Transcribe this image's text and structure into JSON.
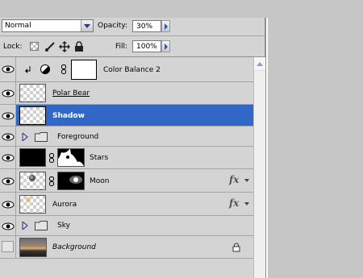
{
  "blend_mode": {
    "value": "Normal"
  },
  "opacity": {
    "label": "Opacity:",
    "value": "30%"
  },
  "lock": {
    "label": "Lock:"
  },
  "fill": {
    "label": "Fill:",
    "value": "100%"
  },
  "layers": [
    {
      "name": "Color Balance 2",
      "type": "adjustment",
      "visible": true
    },
    {
      "name": "Polar Bear",
      "type": "layer",
      "visible": true,
      "underlined": true
    },
    {
      "name": "Shadow",
      "type": "layer",
      "visible": true,
      "selected": true
    },
    {
      "name": "Foreground",
      "type": "group",
      "visible": true
    },
    {
      "name": "Stars",
      "type": "masked",
      "visible": true
    },
    {
      "name": "Moon",
      "type": "masked",
      "visible": true,
      "fx": "fx"
    },
    {
      "name": "Aurora",
      "type": "layer",
      "visible": true,
      "fx": "fx"
    },
    {
      "name": "Sky",
      "type": "group",
      "visible": true
    },
    {
      "name": "Background",
      "type": "background",
      "visible": false,
      "locked": true
    }
  ],
  "colors": {
    "selection": "#3168c6",
    "panel": "#d4d4d4"
  }
}
